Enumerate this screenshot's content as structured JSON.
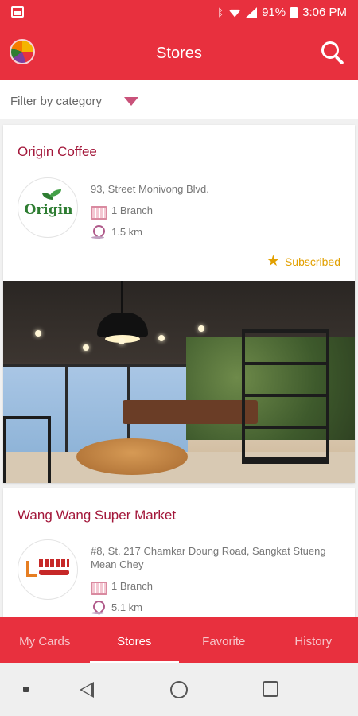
{
  "status_bar": {
    "battery": "91%",
    "time": "3:06 PM",
    "icons": [
      "image-icon",
      "bluetooth-icon",
      "wifi-icon",
      "signal-icon",
      "battery-icon"
    ]
  },
  "app_bar": {
    "title": "Stores",
    "icons": [
      "app-logo",
      "search-icon"
    ]
  },
  "filter": {
    "label": "Filter by category",
    "icon": "caret-down-icon"
  },
  "stores": [
    {
      "name": "Origin Coffee",
      "logo_text": "Origin",
      "address": "93, Street Monivong Blvd.",
      "branches": "1 Branch",
      "distance": "1.5 km",
      "subscribed_label": "Subscribed"
    },
    {
      "name": "Wang Wang Super Market",
      "address": "#8, St. 217 Chamkar Doung Road, Sangkat Stueng Mean Chey",
      "branches": "1 Branch",
      "distance": "5.1 km"
    }
  ],
  "bottom_nav": {
    "tabs": [
      "My Cards",
      "Stores",
      "Favorite",
      "History"
    ],
    "active": "Stores"
  },
  "colors": {
    "primary": "#e8303e",
    "store_name": "#a3173a",
    "subscribed": "#e2a000"
  }
}
